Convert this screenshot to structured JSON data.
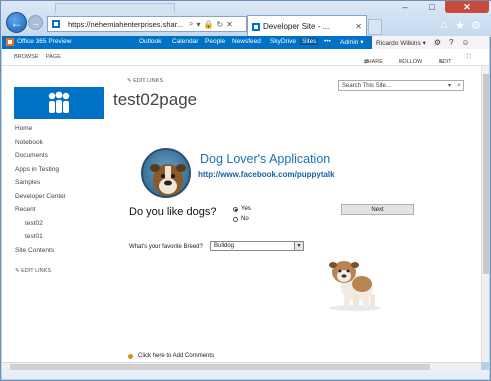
{
  "browser": {
    "address": "https://nehemiahenterprises.shar...",
    "tab_label": "Developer Site - ...",
    "back_label": "←",
    "forward_label": "→"
  },
  "suite_bar": {
    "brand": "Office 365 Preview",
    "links": [
      "Outlook",
      "Calendar",
      "People",
      "Newsfeed",
      "SkyDrive",
      "Sites"
    ],
    "more": "•••",
    "admin": "Admin ▾",
    "user": "Ricardo Wilkins ▾"
  },
  "ribbon": {
    "tabs": [
      "BROWSE",
      "PAGE"
    ],
    "share": "SHARE",
    "follow": "FOLLOW",
    "edit": "EDIT"
  },
  "site": {
    "edit_links": "EDIT LINKS",
    "title": "test02page",
    "search_placeholder": "Search This Site..."
  },
  "quick_launch": {
    "items": [
      "Home",
      "Notebook",
      "Documents",
      "Apps in Testing",
      "Samples",
      "Developer Center",
      "Recent",
      "test02",
      "test01",
      "Site Contents"
    ],
    "edit_links": "EDIT LINKS"
  },
  "app": {
    "title": "Dog Lover's Application",
    "url": "http://www.facebook.com/puppytalk",
    "question": "Do you like dogs?",
    "options": [
      "Yes",
      "No"
    ],
    "selected_option": "Yes",
    "next_label": "Next",
    "breed_label": "What's your favorite Breed?",
    "breed_value": "Bulldog",
    "comments_link": "Click here to Add Comments"
  },
  "colors": {
    "suite_blue": "#0072c6",
    "link_blue": "#1a73b7",
    "window_close": "#c74b3d"
  }
}
